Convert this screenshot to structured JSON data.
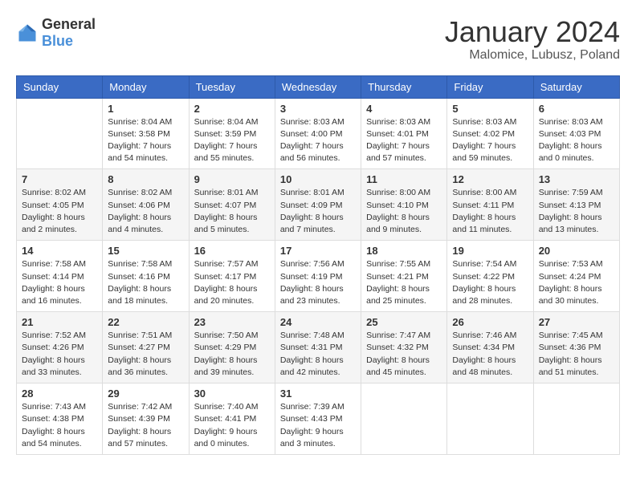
{
  "header": {
    "logo_general": "General",
    "logo_blue": "Blue",
    "month_title": "January 2024",
    "location": "Malomice, Lubusz, Poland"
  },
  "weekdays": [
    "Sunday",
    "Monday",
    "Tuesday",
    "Wednesday",
    "Thursday",
    "Friday",
    "Saturday"
  ],
  "weeks": [
    [
      {
        "day": "",
        "info": ""
      },
      {
        "day": "1",
        "info": "Sunrise: 8:04 AM\nSunset: 3:58 PM\nDaylight: 7 hours\nand 54 minutes."
      },
      {
        "day": "2",
        "info": "Sunrise: 8:04 AM\nSunset: 3:59 PM\nDaylight: 7 hours\nand 55 minutes."
      },
      {
        "day": "3",
        "info": "Sunrise: 8:03 AM\nSunset: 4:00 PM\nDaylight: 7 hours\nand 56 minutes."
      },
      {
        "day": "4",
        "info": "Sunrise: 8:03 AM\nSunset: 4:01 PM\nDaylight: 7 hours\nand 57 minutes."
      },
      {
        "day": "5",
        "info": "Sunrise: 8:03 AM\nSunset: 4:02 PM\nDaylight: 7 hours\nand 59 minutes."
      },
      {
        "day": "6",
        "info": "Sunrise: 8:03 AM\nSunset: 4:03 PM\nDaylight: 8 hours\nand 0 minutes."
      }
    ],
    [
      {
        "day": "7",
        "info": "Sunrise: 8:02 AM\nSunset: 4:05 PM\nDaylight: 8 hours\nand 2 minutes."
      },
      {
        "day": "8",
        "info": "Sunrise: 8:02 AM\nSunset: 4:06 PM\nDaylight: 8 hours\nand 4 minutes."
      },
      {
        "day": "9",
        "info": "Sunrise: 8:01 AM\nSunset: 4:07 PM\nDaylight: 8 hours\nand 5 minutes."
      },
      {
        "day": "10",
        "info": "Sunrise: 8:01 AM\nSunset: 4:09 PM\nDaylight: 8 hours\nand 7 minutes."
      },
      {
        "day": "11",
        "info": "Sunrise: 8:00 AM\nSunset: 4:10 PM\nDaylight: 8 hours\nand 9 minutes."
      },
      {
        "day": "12",
        "info": "Sunrise: 8:00 AM\nSunset: 4:11 PM\nDaylight: 8 hours\nand 11 minutes."
      },
      {
        "day": "13",
        "info": "Sunrise: 7:59 AM\nSunset: 4:13 PM\nDaylight: 8 hours\nand 13 minutes."
      }
    ],
    [
      {
        "day": "14",
        "info": "Sunrise: 7:58 AM\nSunset: 4:14 PM\nDaylight: 8 hours\nand 16 minutes."
      },
      {
        "day": "15",
        "info": "Sunrise: 7:58 AM\nSunset: 4:16 PM\nDaylight: 8 hours\nand 18 minutes."
      },
      {
        "day": "16",
        "info": "Sunrise: 7:57 AM\nSunset: 4:17 PM\nDaylight: 8 hours\nand 20 minutes."
      },
      {
        "day": "17",
        "info": "Sunrise: 7:56 AM\nSunset: 4:19 PM\nDaylight: 8 hours\nand 23 minutes."
      },
      {
        "day": "18",
        "info": "Sunrise: 7:55 AM\nSunset: 4:21 PM\nDaylight: 8 hours\nand 25 minutes."
      },
      {
        "day": "19",
        "info": "Sunrise: 7:54 AM\nSunset: 4:22 PM\nDaylight: 8 hours\nand 28 minutes."
      },
      {
        "day": "20",
        "info": "Sunrise: 7:53 AM\nSunset: 4:24 PM\nDaylight: 8 hours\nand 30 minutes."
      }
    ],
    [
      {
        "day": "21",
        "info": "Sunrise: 7:52 AM\nSunset: 4:26 PM\nDaylight: 8 hours\nand 33 minutes."
      },
      {
        "day": "22",
        "info": "Sunrise: 7:51 AM\nSunset: 4:27 PM\nDaylight: 8 hours\nand 36 minutes."
      },
      {
        "day": "23",
        "info": "Sunrise: 7:50 AM\nSunset: 4:29 PM\nDaylight: 8 hours\nand 39 minutes."
      },
      {
        "day": "24",
        "info": "Sunrise: 7:48 AM\nSunset: 4:31 PM\nDaylight: 8 hours\nand 42 minutes."
      },
      {
        "day": "25",
        "info": "Sunrise: 7:47 AM\nSunset: 4:32 PM\nDaylight: 8 hours\nand 45 minutes."
      },
      {
        "day": "26",
        "info": "Sunrise: 7:46 AM\nSunset: 4:34 PM\nDaylight: 8 hours\nand 48 minutes."
      },
      {
        "day": "27",
        "info": "Sunrise: 7:45 AM\nSunset: 4:36 PM\nDaylight: 8 hours\nand 51 minutes."
      }
    ],
    [
      {
        "day": "28",
        "info": "Sunrise: 7:43 AM\nSunset: 4:38 PM\nDaylight: 8 hours\nand 54 minutes."
      },
      {
        "day": "29",
        "info": "Sunrise: 7:42 AM\nSunset: 4:39 PM\nDaylight: 8 hours\nand 57 minutes."
      },
      {
        "day": "30",
        "info": "Sunrise: 7:40 AM\nSunset: 4:41 PM\nDaylight: 9 hours\nand 0 minutes."
      },
      {
        "day": "31",
        "info": "Sunrise: 7:39 AM\nSunset: 4:43 PM\nDaylight: 9 hours\nand 3 minutes."
      },
      {
        "day": "",
        "info": ""
      },
      {
        "day": "",
        "info": ""
      },
      {
        "day": "",
        "info": ""
      }
    ]
  ]
}
